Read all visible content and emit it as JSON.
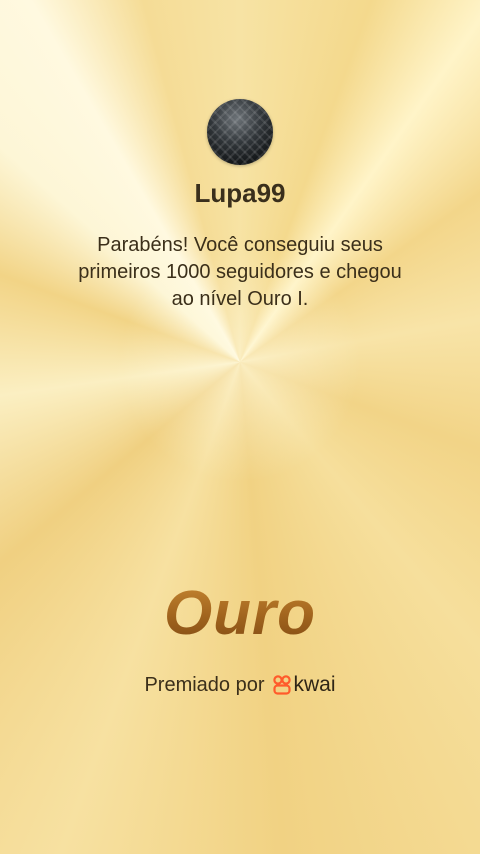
{
  "profile": {
    "username": "Lupa99"
  },
  "congrats": {
    "lines": [
      "Parabéns! Você conseguiu seus",
      "primeiros 1000 seguidores e chegou",
      "ao nível Ouro I."
    ]
  },
  "level": {
    "name": "Ouro"
  },
  "footer": {
    "awarded_label": "Premiado por",
    "brand": "kwai",
    "brand_icon": "kwai-logo-icon",
    "brand_color": "#ff5b2b"
  },
  "colors": {
    "background": "#f6d98a",
    "level_text": "#a5671c",
    "text": "#3b2f1a"
  }
}
